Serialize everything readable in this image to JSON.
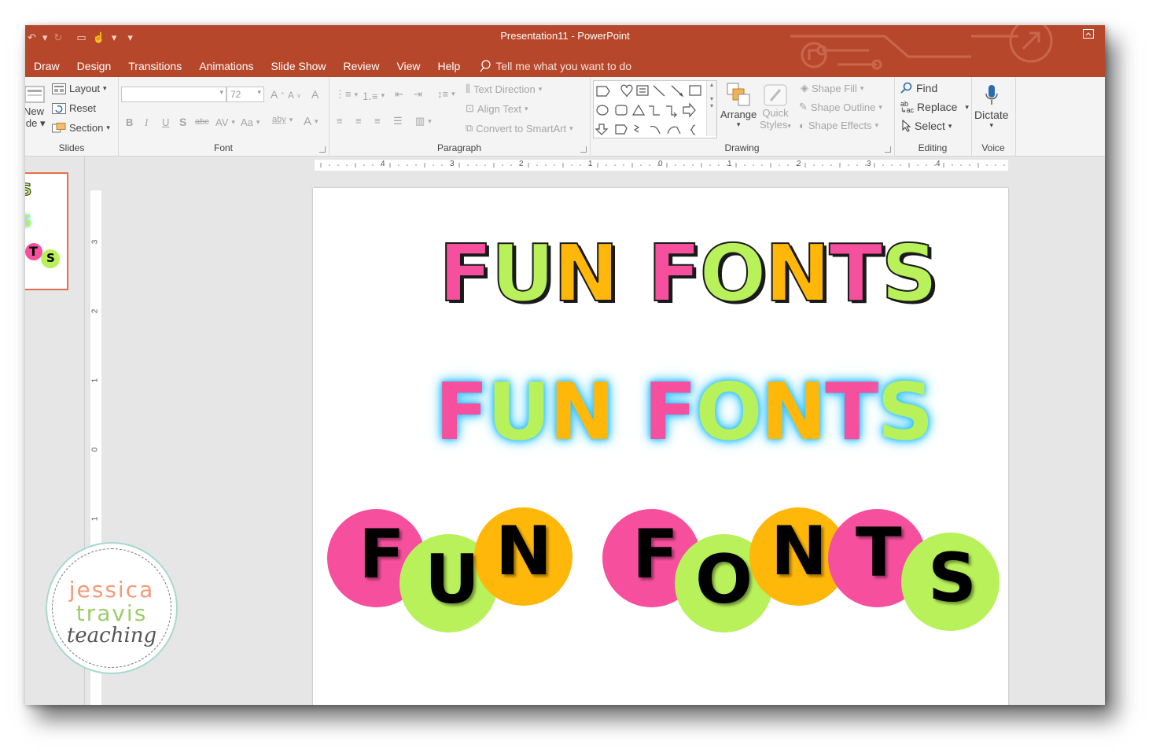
{
  "window": {
    "title": "Presentation11  -  PowerPoint"
  },
  "qat": {
    "undo": "↶",
    "redo": "↻",
    "present": "▭",
    "touch": "☝",
    "more": "▾"
  },
  "tabs": [
    "Draw",
    "Design",
    "Transitions",
    "Animations",
    "Slide Show",
    "Review",
    "View",
    "Help"
  ],
  "tellme": {
    "placeholder": "Tell me what you want to do"
  },
  "ribbon": {
    "slides": {
      "label": "Slides",
      "new_slide_line1": "New",
      "new_slide_line2": "ide",
      "layout": "Layout",
      "reset": "Reset",
      "section": "Section"
    },
    "font": {
      "label": "Font",
      "font_size": "72",
      "bold": "B",
      "italic": "I",
      "underline": "U",
      "shadow": "S",
      "strike": "abc",
      "spacing": "AV",
      "case": "Aa",
      "grow": "A",
      "shrink": "A",
      "clear": "A",
      "highlight": "aby",
      "color": "A"
    },
    "paragraph": {
      "label": "Paragraph",
      "text_direction": "Text Direction",
      "align_text": "Align Text",
      "convert_smartart": "Convert to SmartArt"
    },
    "drawing": {
      "label": "Drawing",
      "arrange": "Arrange",
      "quick_styles_1": "Quick",
      "quick_styles_2": "Styles",
      "shape_fill": "Shape Fill",
      "shape_outline": "Shape Outline",
      "shape_effects": "Shape Effects"
    },
    "editing": {
      "label": "Editing",
      "find": "Find",
      "replace": "Replace",
      "select": "Select"
    },
    "voice": {
      "label": "Voice",
      "dictate": "Dictate"
    }
  },
  "ruler": {
    "h_labels": [
      "4",
      "3",
      "2",
      "1",
      "0",
      "1",
      "2",
      "3",
      "4"
    ],
    "v_labels": [
      "3",
      "2",
      "1",
      "0",
      "1"
    ]
  },
  "slide": {
    "line1": "FUN FONTS",
    "line2": "FUN FONTS",
    "line3_word1": [
      "F",
      "U",
      "N"
    ],
    "line3_word2": [
      "F",
      "O",
      "N",
      "T",
      "S"
    ],
    "letters": [
      "F",
      "U",
      "N",
      "F",
      "O",
      "N",
      "T",
      "S"
    ]
  },
  "thumbnail": {
    "row1": "S",
    "row2": "S",
    "t": "T",
    "s": "S"
  },
  "logo": {
    "line1": "jessica",
    "line2": "travis",
    "line3": "teaching"
  },
  "colors": {
    "brand": "#b7472a",
    "pink": "#f64f9d",
    "green": "#b8f15a",
    "yellow": "#ffb80a",
    "glow": "#33c4ff"
  }
}
